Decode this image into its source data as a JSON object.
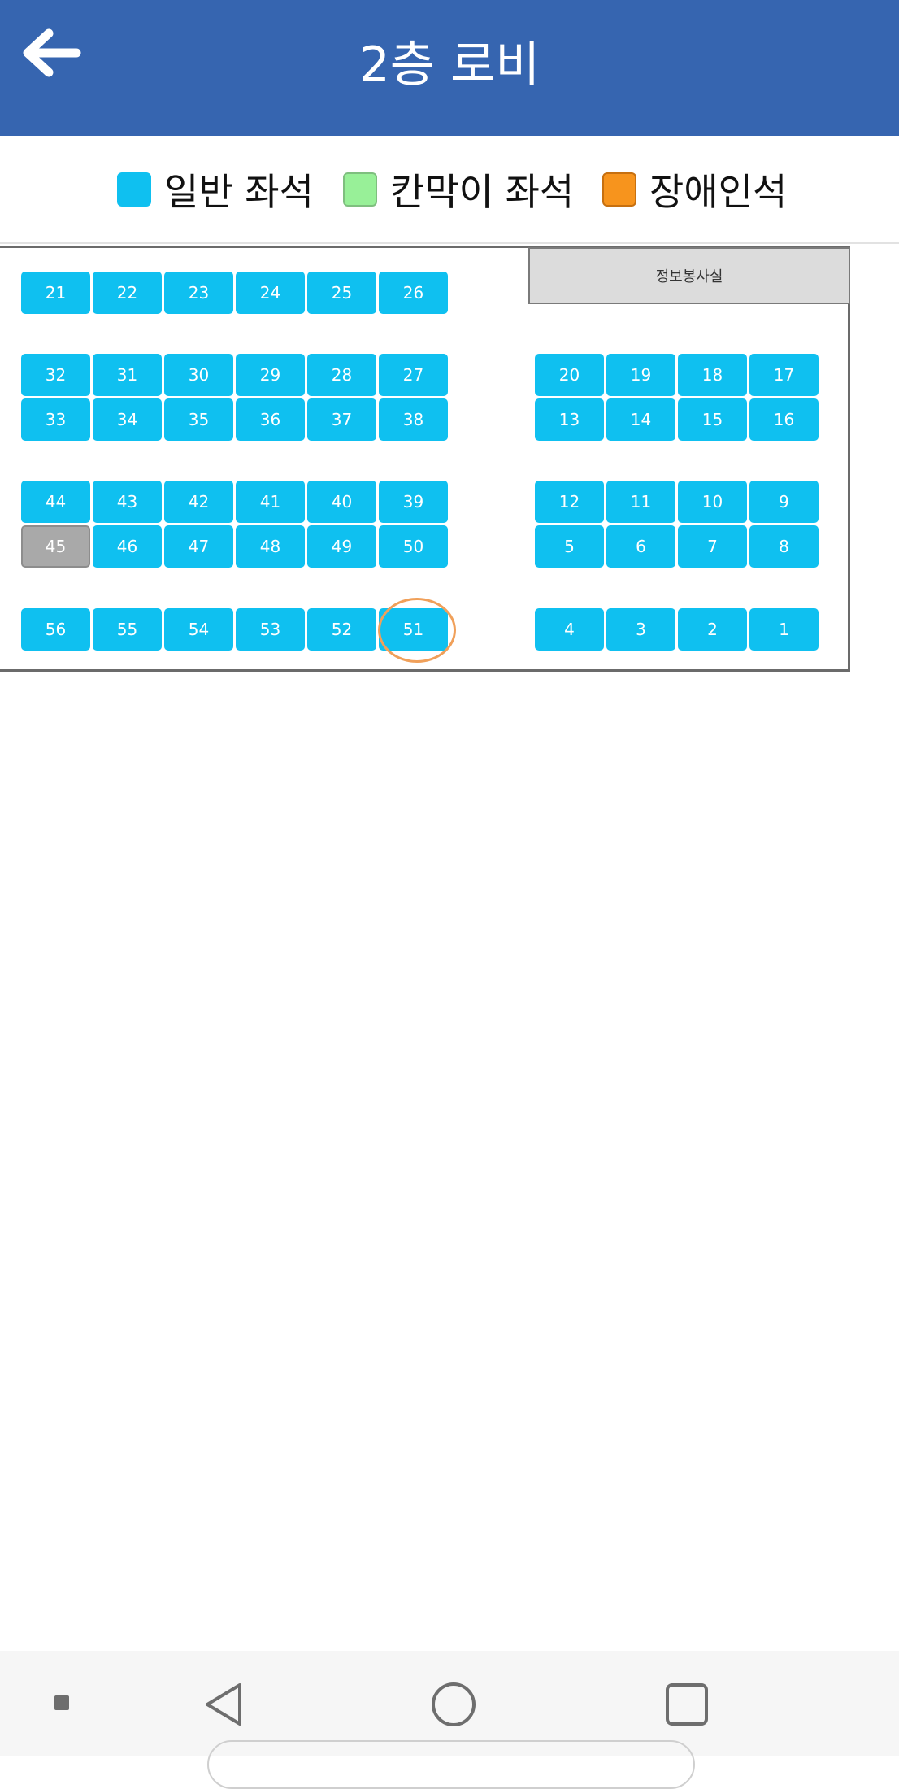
{
  "header": {
    "title": "2층 로비",
    "back_icon": "arrow-left-icon"
  },
  "legend": [
    {
      "label": "일반 좌석",
      "color": "#0fc0f0"
    },
    {
      "label": "칸막이 좌석",
      "color": "#98f098"
    },
    {
      "label": "장애인석",
      "color": "#f7941d"
    }
  ],
  "room": {
    "label": "정보봉사실"
  },
  "seats": {
    "row_a": [
      "21",
      "22",
      "23",
      "24",
      "25",
      "26"
    ],
    "row_b_left": [
      "32",
      "31",
      "30",
      "29",
      "28",
      "27"
    ],
    "row_c_left": [
      "33",
      "34",
      "35",
      "36",
      "37",
      "38"
    ],
    "row_d_left": [
      "44",
      "43",
      "42",
      "41",
      "40",
      "39"
    ],
    "row_e_left": [
      "45",
      "46",
      "47",
      "48",
      "49",
      "50"
    ],
    "row_f_left": [
      "56",
      "55",
      "54",
      "53",
      "52",
      "51"
    ],
    "row_b_right": [
      "20",
      "19",
      "18",
      "17"
    ],
    "row_c_right": [
      "13",
      "14",
      "15",
      "16"
    ],
    "row_d_right": [
      "12",
      "11",
      "10",
      "9"
    ],
    "row_e_right": [
      "5",
      "6",
      "7",
      "8"
    ],
    "row_f_right": [
      "4",
      "3",
      "2",
      "1"
    ],
    "taken": [
      "45"
    ],
    "highlighted": "51"
  },
  "navigation_bar": {
    "buttons": [
      "menu-dot-icon",
      "back-triangle-icon",
      "home-circle-icon",
      "recents-square-icon"
    ]
  }
}
